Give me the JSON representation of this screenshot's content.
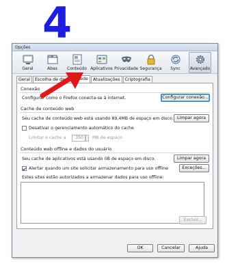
{
  "step": "4",
  "window": {
    "title": "Opções",
    "toolbar": [
      {
        "label": "Geral",
        "icon": "general-icon"
      },
      {
        "label": "Abas",
        "icon": "tabs-icon"
      },
      {
        "label": "Conteúdo",
        "icon": "content-icon"
      },
      {
        "label": "Aplicativos",
        "icon": "applications-icon"
      },
      {
        "label": "Privacidade",
        "icon": "privacy-mask-icon"
      },
      {
        "label": "Segurança",
        "icon": "security-lock-icon"
      },
      {
        "label": "Sync",
        "icon": "sync-icon"
      },
      {
        "label": "Avançado",
        "icon": "advanced-gear-icon",
        "active": true
      }
    ],
    "tabs": [
      "Geral",
      "Escolha de dados",
      "Rede",
      "Atualizações",
      "Criptografia"
    ],
    "selected_tab": "Rede"
  },
  "connection": {
    "title": "Conexão",
    "description": "Configurar como o Firefox conecta-se à internet.",
    "configure_button": "Configurar conexão..."
  },
  "web_cache": {
    "title": "Cache de conteúdo web",
    "usage": "Seu cache de conteúdo web está usando 89,4MB de espaço em disco.",
    "clear_button": "Limpar agora",
    "override_checkbox": "Desativar o gerenciamento automático do cache",
    "limit_label": "Limitar o cache a",
    "limit_value": "350",
    "limit_unit": "MB de espaço"
  },
  "offline": {
    "title": "Conteúdo web offline e dados do usuário",
    "usage": "Seu cache de aplicativos está usando 0B de espaço em disco.",
    "clear_button": "Limpar agora",
    "alert_checkbox": "Alertar quando um site solicitar armazenamento para uso offline",
    "exceptions_button": "Exceções...",
    "sites_label": "Estes sites estão autorizados a armazenar dados para uso offline:",
    "remove_button": "Excluir..."
  },
  "footer": {
    "ok": "OK",
    "cancel": "Cancelar",
    "help": "Ajuda"
  },
  "colors": {
    "step_number": "#1e1ee0",
    "arrow": "#e01818",
    "window_bg": "#f0f0f0"
  }
}
